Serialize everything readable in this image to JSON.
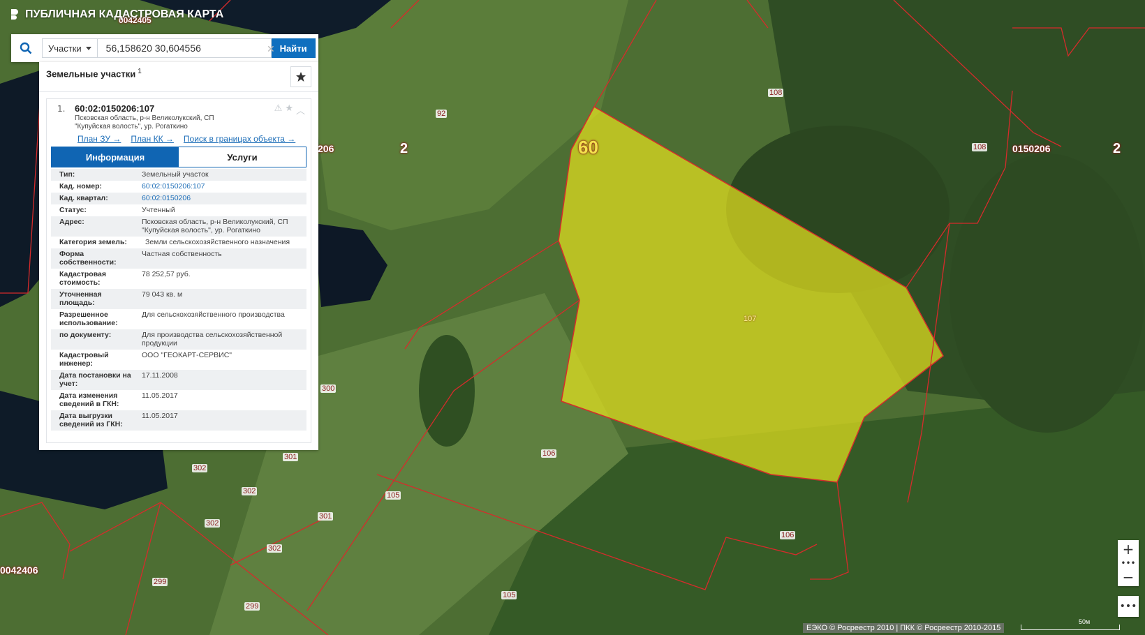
{
  "app": {
    "title": "ПУБЛИЧНАЯ КАДАСТРОВАЯ КАРТА"
  },
  "search": {
    "type_selected": "Участки",
    "query": "56,158620 30,604556",
    "button_label": "Найти"
  },
  "panel": {
    "title": "Земельные участки",
    "count": "1",
    "result": {
      "index": "1.",
      "cadastral_number": "60:02:0150206:107",
      "address": "Псковская область, р-н Великолукский, СП \"Купуйская волость\", ур. Рогаткино",
      "links": [
        "План ЗУ →",
        "План КК →",
        "Поиск в границах объекта →"
      ],
      "tabs": {
        "active": "Информация",
        "inactive": "Услуги"
      },
      "fields": [
        {
          "label": "Тип:",
          "value": "Земельный участок"
        },
        {
          "label": "Кад. номер:",
          "value": "60:02:0150206:107",
          "link": true
        },
        {
          "label": "Кад. квартал:",
          "value": "60:02:0150206",
          "link": true
        },
        {
          "label": "Статус:",
          "value": "Учтенный"
        },
        {
          "label": "Адрес:",
          "value": "Псковская область, р-н Великолукский, СП \"Купуйская волость\", ур. Рогаткино"
        },
        {
          "label": "Категория земель:",
          "value": "Земли сельскохозяйственного назначения"
        },
        {
          "label": "Форма собственности:",
          "value": "Частная собственность"
        },
        {
          "label": "Кадастровая стоимость:",
          "value": "78 252,57 руб."
        },
        {
          "label": "Уточненная площадь:",
          "value": "79 043 кв. м"
        },
        {
          "label": "Разрешенное использование:",
          "value": "Для сельскохозяйственного производства"
        },
        {
          "label": "по документу:",
          "value": "Для производства сельскохозяйственной продукции"
        },
        {
          "label": "Кадастровый инженер:",
          "value": "ООО \"ГЕОКАРТ-СЕРВИС\""
        },
        {
          "label": "Дата постановки на учет:",
          "value": "17.11.2008"
        },
        {
          "label": "Дата изменения сведений в ГКН:",
          "value": "11.05.2017"
        },
        {
          "label": "Дата выгрузки сведений из ГКН:",
          "value": "11.05.2017"
        }
      ]
    }
  },
  "map": {
    "labels": {
      "l60": "60",
      "l107": "107",
      "l2a": "2",
      "l2b": "2",
      "l206": "206",
      "l0150206": "0150206",
      "l0042406": "0042406",
      "l0042405": "0042405",
      "n92": "92",
      "n108a": "108",
      "n108b": "108",
      "n300": "300",
      "n301a": "301",
      "n301b": "301",
      "n302a": "302",
      "n302b": "302",
      "n302c": "302",
      "n302d": "302",
      "n105a": "105",
      "n105b": "105",
      "n106a": "106",
      "n106b": "106",
      "n299a": "299",
      "n299b": "299"
    },
    "highlight_color": "#e3e01f",
    "boundary_color": "#d62b2b"
  },
  "controls": {
    "zoom_in": "+",
    "zoom_out": "−",
    "more": "•••"
  },
  "footer": {
    "copyright": "ЕЭКО © Росреестр 2010 | ПКК © Росреестр 2010-2015",
    "scale": "50м"
  }
}
